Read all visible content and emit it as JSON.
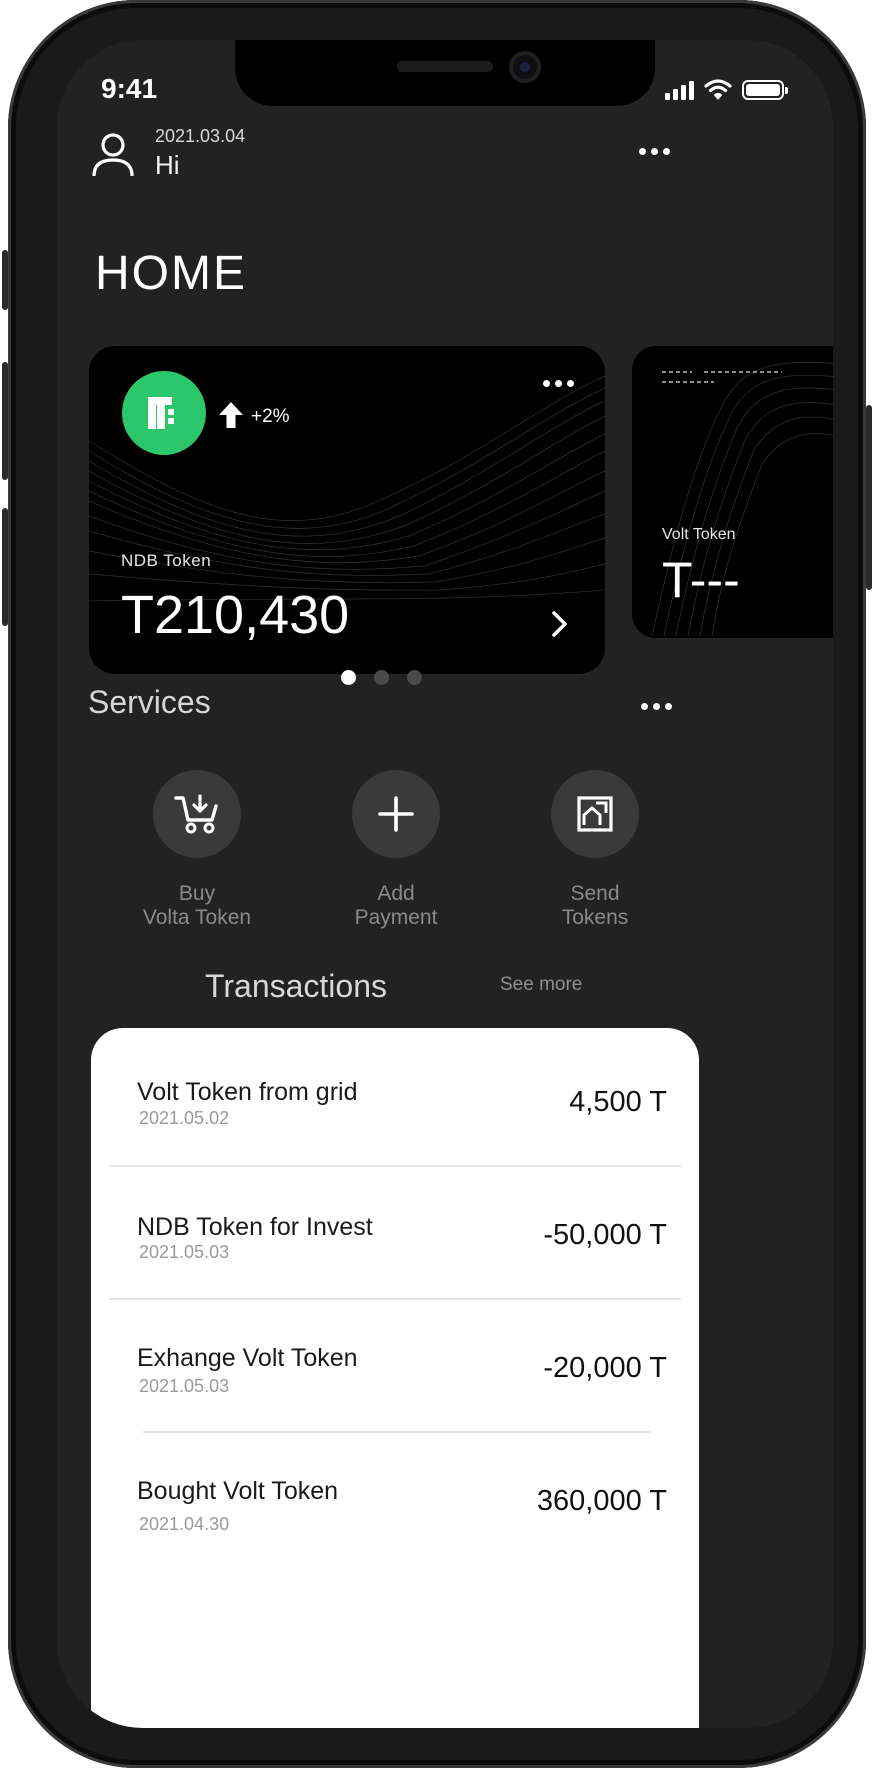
{
  "status_bar": {
    "time": "9:41"
  },
  "header": {
    "date": "2021.03.04",
    "greeting": "Hi"
  },
  "page": {
    "title": "HOME"
  },
  "cards": [
    {
      "label": "NDB Token",
      "amount": "T210,430",
      "trend": "+2%",
      "badge_color": "#2bc76a"
    },
    {
      "label": "Volt Token",
      "amount": "T---"
    }
  ],
  "pager": {
    "count": 3,
    "active_index": 0
  },
  "services": {
    "title": "Services",
    "items": [
      {
        "label": "Buy\nVolta Token",
        "icon": "cart-icon"
      },
      {
        "label": "Add\nPayment",
        "icon": "plus-icon"
      },
      {
        "label": "Send\nTokens",
        "icon": "send-icon"
      }
    ]
  },
  "transactions": {
    "title": "Transactions",
    "see_more": "See more",
    "items": [
      {
        "name": "Volt Token from grid",
        "date": "2021.05.02",
        "amount": "4,500 T"
      },
      {
        "name": "NDB Token for Invest",
        "date": "2021.05.03",
        "amount": "-50,000 T"
      },
      {
        "name": "Exhange Volt  Token",
        "date": "2021.05.03",
        "amount": "-20,000 T"
      },
      {
        "name": "Bought Volt  Token",
        "date": "2021.04.30",
        "amount": "360,000 T"
      }
    ]
  },
  "colors": {
    "background": "#222222",
    "card": "#000000",
    "accent": "#2bc76a",
    "panel": "#ffffff"
  }
}
